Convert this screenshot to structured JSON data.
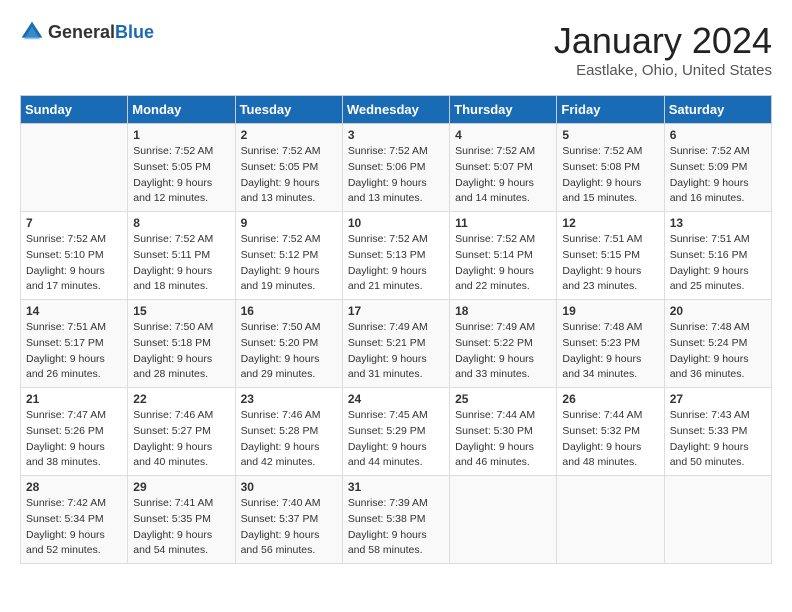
{
  "header": {
    "logo_general": "General",
    "logo_blue": "Blue",
    "month_title": "January 2024",
    "location": "Eastlake, Ohio, United States"
  },
  "days_of_week": [
    "Sunday",
    "Monday",
    "Tuesday",
    "Wednesday",
    "Thursday",
    "Friday",
    "Saturday"
  ],
  "weeks": [
    [
      {
        "day": "",
        "info": ""
      },
      {
        "day": "1",
        "info": "Sunrise: 7:52 AM\nSunset: 5:05 PM\nDaylight: 9 hours\nand 12 minutes."
      },
      {
        "day": "2",
        "info": "Sunrise: 7:52 AM\nSunset: 5:05 PM\nDaylight: 9 hours\nand 13 minutes."
      },
      {
        "day": "3",
        "info": "Sunrise: 7:52 AM\nSunset: 5:06 PM\nDaylight: 9 hours\nand 13 minutes."
      },
      {
        "day": "4",
        "info": "Sunrise: 7:52 AM\nSunset: 5:07 PM\nDaylight: 9 hours\nand 14 minutes."
      },
      {
        "day": "5",
        "info": "Sunrise: 7:52 AM\nSunset: 5:08 PM\nDaylight: 9 hours\nand 15 minutes."
      },
      {
        "day": "6",
        "info": "Sunrise: 7:52 AM\nSunset: 5:09 PM\nDaylight: 9 hours\nand 16 minutes."
      }
    ],
    [
      {
        "day": "7",
        "info": "Sunrise: 7:52 AM\nSunset: 5:10 PM\nDaylight: 9 hours\nand 17 minutes."
      },
      {
        "day": "8",
        "info": "Sunrise: 7:52 AM\nSunset: 5:11 PM\nDaylight: 9 hours\nand 18 minutes."
      },
      {
        "day": "9",
        "info": "Sunrise: 7:52 AM\nSunset: 5:12 PM\nDaylight: 9 hours\nand 19 minutes."
      },
      {
        "day": "10",
        "info": "Sunrise: 7:52 AM\nSunset: 5:13 PM\nDaylight: 9 hours\nand 21 minutes."
      },
      {
        "day": "11",
        "info": "Sunrise: 7:52 AM\nSunset: 5:14 PM\nDaylight: 9 hours\nand 22 minutes."
      },
      {
        "day": "12",
        "info": "Sunrise: 7:51 AM\nSunset: 5:15 PM\nDaylight: 9 hours\nand 23 minutes."
      },
      {
        "day": "13",
        "info": "Sunrise: 7:51 AM\nSunset: 5:16 PM\nDaylight: 9 hours\nand 25 minutes."
      }
    ],
    [
      {
        "day": "14",
        "info": "Sunrise: 7:51 AM\nSunset: 5:17 PM\nDaylight: 9 hours\nand 26 minutes."
      },
      {
        "day": "15",
        "info": "Sunrise: 7:50 AM\nSunset: 5:18 PM\nDaylight: 9 hours\nand 28 minutes."
      },
      {
        "day": "16",
        "info": "Sunrise: 7:50 AM\nSunset: 5:20 PM\nDaylight: 9 hours\nand 29 minutes."
      },
      {
        "day": "17",
        "info": "Sunrise: 7:49 AM\nSunset: 5:21 PM\nDaylight: 9 hours\nand 31 minutes."
      },
      {
        "day": "18",
        "info": "Sunrise: 7:49 AM\nSunset: 5:22 PM\nDaylight: 9 hours\nand 33 minutes."
      },
      {
        "day": "19",
        "info": "Sunrise: 7:48 AM\nSunset: 5:23 PM\nDaylight: 9 hours\nand 34 minutes."
      },
      {
        "day": "20",
        "info": "Sunrise: 7:48 AM\nSunset: 5:24 PM\nDaylight: 9 hours\nand 36 minutes."
      }
    ],
    [
      {
        "day": "21",
        "info": "Sunrise: 7:47 AM\nSunset: 5:26 PM\nDaylight: 9 hours\nand 38 minutes."
      },
      {
        "day": "22",
        "info": "Sunrise: 7:46 AM\nSunset: 5:27 PM\nDaylight: 9 hours\nand 40 minutes."
      },
      {
        "day": "23",
        "info": "Sunrise: 7:46 AM\nSunset: 5:28 PM\nDaylight: 9 hours\nand 42 minutes."
      },
      {
        "day": "24",
        "info": "Sunrise: 7:45 AM\nSunset: 5:29 PM\nDaylight: 9 hours\nand 44 minutes."
      },
      {
        "day": "25",
        "info": "Sunrise: 7:44 AM\nSunset: 5:30 PM\nDaylight: 9 hours\nand 46 minutes."
      },
      {
        "day": "26",
        "info": "Sunrise: 7:44 AM\nSunset: 5:32 PM\nDaylight: 9 hours\nand 48 minutes."
      },
      {
        "day": "27",
        "info": "Sunrise: 7:43 AM\nSunset: 5:33 PM\nDaylight: 9 hours\nand 50 minutes."
      }
    ],
    [
      {
        "day": "28",
        "info": "Sunrise: 7:42 AM\nSunset: 5:34 PM\nDaylight: 9 hours\nand 52 minutes."
      },
      {
        "day": "29",
        "info": "Sunrise: 7:41 AM\nSunset: 5:35 PM\nDaylight: 9 hours\nand 54 minutes."
      },
      {
        "day": "30",
        "info": "Sunrise: 7:40 AM\nSunset: 5:37 PM\nDaylight: 9 hours\nand 56 minutes."
      },
      {
        "day": "31",
        "info": "Sunrise: 7:39 AM\nSunset: 5:38 PM\nDaylight: 9 hours\nand 58 minutes."
      },
      {
        "day": "",
        "info": ""
      },
      {
        "day": "",
        "info": ""
      },
      {
        "day": "",
        "info": ""
      }
    ]
  ]
}
